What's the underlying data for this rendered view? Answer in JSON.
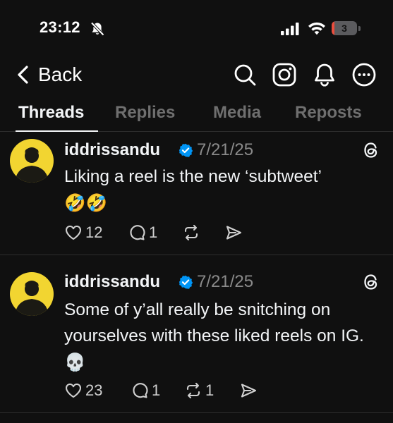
{
  "status_bar": {
    "time": "23:12",
    "battery_level": "3",
    "battery_fraction": 0.12,
    "icons": [
      "bell-slash-icon",
      "cellular-signal-icon",
      "wifi-icon",
      "battery-icon"
    ]
  },
  "nav": {
    "back_label": "Back",
    "icons": [
      "search-icon",
      "instagram-icon",
      "notifications-icon",
      "more-icon"
    ]
  },
  "tabs": [
    {
      "label": "Threads",
      "active": true
    },
    {
      "label": "Replies",
      "active": false
    },
    {
      "label": "Media",
      "active": false
    },
    {
      "label": "Reposts",
      "active": false
    }
  ],
  "posts": [
    {
      "username": "iddrissandu",
      "verified": true,
      "date": "7/21/25",
      "text": "Liking a reel is the new ‘subtweet’",
      "emoji": "🤣🤣",
      "likes": "12",
      "replies": "1",
      "reposts": ""
    },
    {
      "username": "iddrissandu",
      "verified": true,
      "date": "7/21/25",
      "text": "Some of y’all really be snitching on yourselves with these liked reels on IG.",
      "emoji": "💀",
      "likes": "23",
      "replies": "1",
      "reposts": "1"
    }
  ],
  "colors": {
    "background": "#101010",
    "text": "#f3f5f7",
    "muted": "#8a8a8a",
    "inactive_tab": "#6f6f6f",
    "verified": "#0095f6",
    "battery_fill": "#ea4d3d",
    "divider": "#2d2d2d",
    "avatar_bg": "#f2d531"
  }
}
